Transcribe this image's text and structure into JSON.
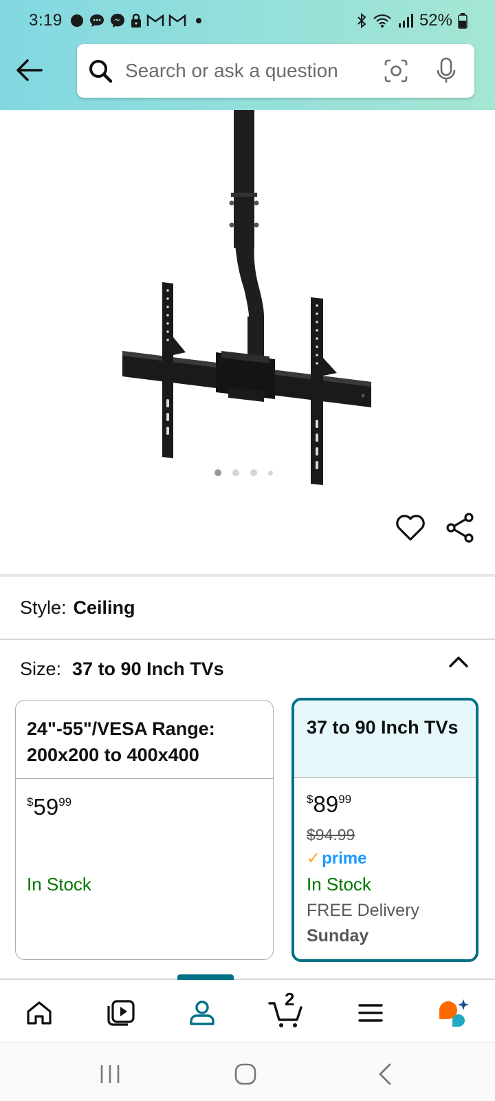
{
  "status_bar": {
    "time": "3:19",
    "battery": "52%",
    "notification_icons": [
      "signal-app-icon",
      "messages-icon",
      "messenger-icon",
      "lock-icon",
      "gmail-icon",
      "gmail-icon",
      "more-dot-icon"
    ]
  },
  "search": {
    "placeholder": "Search or ask a question"
  },
  "gallery": {
    "image_count": 4,
    "active_index": 0
  },
  "style": {
    "label": "Style:",
    "value": "Ceiling"
  },
  "size": {
    "label": "Size:",
    "value": "37 to 90 Inch TVs"
  },
  "options": [
    {
      "title": "24\"-55\"/VESA Range: 200x200 to 400x400",
      "price_symbol": "$",
      "price_whole": "59",
      "price_cents": "99",
      "availability": "In Stock",
      "selected": false
    },
    {
      "title": "37 to 90 Inch TVs",
      "price_symbol": "$",
      "price_whole": "89",
      "price_cents": "99",
      "list_price": "$94.99",
      "prime_label": "prime",
      "availability": "In Stock",
      "delivery": "FREE Delivery",
      "delivery_day": "Sunday",
      "selected": true
    }
  ],
  "bottom_nav": {
    "cart_count": "2",
    "active": "account",
    "items": [
      "home-icon",
      "video-icon",
      "account-icon",
      "cart-icon",
      "menu-icon",
      "rufus-icon"
    ]
  },
  "colors": {
    "accent": "#007185",
    "in_stock": "#007600",
    "prime": "#1a98ff",
    "header_gradient_start": "#82d8e1",
    "header_gradient_end": "#a5e6d4"
  }
}
